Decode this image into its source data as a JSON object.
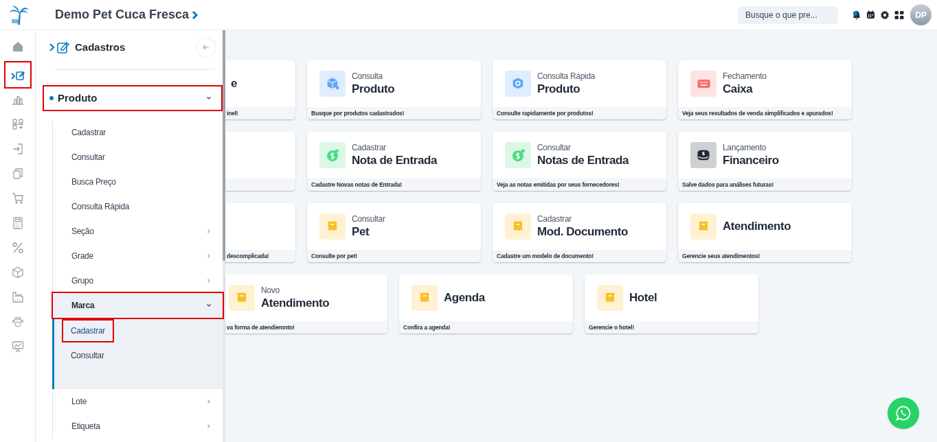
{
  "header": {
    "title": "Demo Pet Cuca Fresca",
    "search_placeholder": "Busque o que pre...",
    "avatar": "DP",
    "notification_dot": true
  },
  "rail": [
    {
      "selected": false,
      "highlighted": false
    },
    {
      "selected": true,
      "highlighted": true
    },
    {
      "selected": false,
      "highlighted": false
    },
    {
      "selected": false,
      "highlighted": false
    },
    {
      "selected": false,
      "highlighted": false
    },
    {
      "selected": false,
      "highlighted": false
    },
    {
      "selected": false,
      "highlighted": false
    },
    {
      "selected": false,
      "highlighted": false
    },
    {
      "selected": false,
      "highlighted": false
    },
    {
      "selected": false,
      "highlighted": false
    },
    {
      "selected": false,
      "highlighted": false
    },
    {
      "selected": false,
      "highlighted": false
    },
    {
      "selected": false,
      "highlighted": false
    }
  ],
  "panel": {
    "title": "Cadastros",
    "section": {
      "label": "Produto",
      "expanded": true,
      "highlighted": true,
      "children": [
        {
          "kind": "link",
          "label": "Cadastrar"
        },
        {
          "kind": "link",
          "label": "Consultar"
        },
        {
          "kind": "link",
          "label": "Busca Preço"
        },
        {
          "kind": "link",
          "label": "Consulta Rápida"
        },
        {
          "kind": "group",
          "label": "Seção",
          "expanded": false,
          "highlighted": false
        },
        {
          "kind": "group",
          "label": "Grade",
          "expanded": false,
          "highlighted": false
        },
        {
          "kind": "group",
          "label": "Grupo",
          "expanded": false,
          "highlighted": false
        },
        {
          "kind": "group",
          "label": "Marca",
          "expanded": true,
          "highlighted": true,
          "children": [
            {
              "label": "Cadastrar",
              "selected": true,
              "highlighted": true
            },
            {
              "label": "Consultar",
              "selected": false,
              "highlighted": false
            }
          ]
        },
        {
          "kind": "group",
          "label": "Lote",
          "expanded": false,
          "highlighted": false
        },
        {
          "kind": "group",
          "label": "Etiqueta",
          "expanded": false,
          "highlighted": false
        }
      ]
    }
  },
  "card_rows": [
    [
      {
        "kind": "partial",
        "title": "e",
        "footer": "inel!"
      },
      {
        "kind": "full",
        "color": "#60a5fa",
        "subtitle": "Consulta",
        "title": "Produto",
        "footer": "Busque por produtos cadastrados!"
      },
      {
        "kind": "full",
        "color": "#60a5fa",
        "subtitle": "Consulta Rápida",
        "title": "Produto",
        "footer": "Consulte rapidamente por produtos!"
      },
      {
        "kind": "full",
        "color": "#f87171",
        "subtitle": "Fechamento",
        "title": "Caixa",
        "footer": "Veja seus resultados de venda simplificados e apurados!"
      }
    ],
    [
      {
        "kind": "partial"
      },
      {
        "kind": "full",
        "color": "#4ade80",
        "subtitle": "Cadastrar",
        "title": "Nota de Entrada",
        "footer": "Cadastre Novas notas de Entrada!"
      },
      {
        "kind": "full",
        "color": "#4ade80",
        "subtitle": "Consultar",
        "title": "Notas de Entrada",
        "footer": "Veja as notas emitidas por seus fornecedores!"
      },
      {
        "kind": "full",
        "color": "#1f2937",
        "subtitle": "Lançamento",
        "title": "Financeiro",
        "footer": "Salve dados para análises futuras!"
      }
    ],
    [
      {
        "kind": "partial",
        "footer": "descomplicada!"
      },
      {
        "kind": "full",
        "color": "#fbbf24",
        "subtitle": "Consultar",
        "title": "Pet",
        "footer": "Consulte por pet!"
      },
      {
        "kind": "full",
        "color": "#fbbf24",
        "subtitle": "Cadastrar",
        "title": "Mod. Documento",
        "footer": "Cadastre um modelo de documento!"
      },
      {
        "kind": "full",
        "color": "#fbbf24",
        "title": "Atendimento",
        "footer": "Gerencie seus atendimentos!"
      }
    ],
    [
      {
        "kind": "partial-wide",
        "color": "#fbbf24",
        "subtitle": "Novo",
        "title": "Atendimento",
        "footer": "va forma de atendiemnto!"
      },
      {
        "kind": "full",
        "color": "#fbbf24",
        "title": "Agenda",
        "footer": "Confira a agenda!"
      },
      {
        "kind": "full",
        "color": "#fbbf24",
        "title": "Hotel",
        "footer": "Gerencie o hotel!"
      }
    ]
  ]
}
